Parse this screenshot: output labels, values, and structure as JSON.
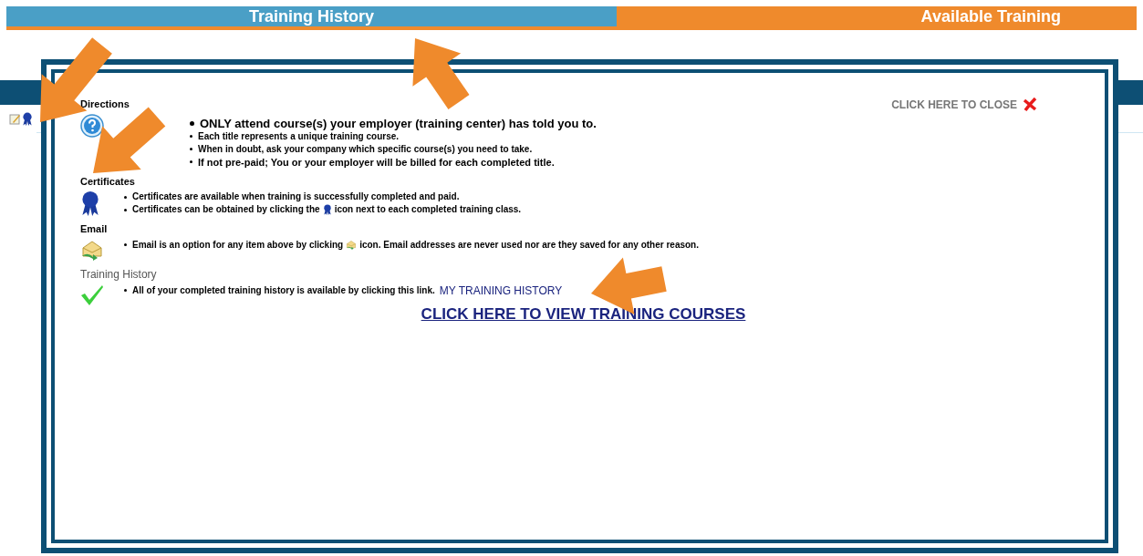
{
  "tabs": [
    {
      "label": "Training History",
      "color": "#4a9fc6"
    },
    {
      "label": "Available Training",
      "color": "#ef8a2c"
    }
  ],
  "close_link": "CLICK HERE TO CLOSE",
  "sections": [
    {
      "title": "Directions",
      "kind": "help",
      "bullets": [
        {
          "text": "ONLY attend course(s) your employer (training center) has told you to."
        },
        {
          "text": "Each title represents a unique training course."
        },
        {
          "text": "When in doubt, ask your company which specific course(s) you need to take."
        },
        {
          "text": "If not pre-paid; You or your employer will be billed for each completed title."
        }
      ]
    },
    {
      "title": "Certificates",
      "kind": "ribbon",
      "bullets": [
        {
          "text": "Certificates are available when training is successfully completed and paid."
        },
        {
          "text": "Certificates can be obtained by clicking the",
          "after": "icon next to each completed training class."
        }
      ]
    },
    {
      "title": "Email",
      "kind": "email",
      "bullets": [
        {
          "text": "Email is an option for any item above by clicking",
          "after": "icon. Email addresses are never used nor are they saved for any other reason."
        }
      ]
    },
    {
      "title": "Training History",
      "kind": "check",
      "bullets": [
        {
          "text": "All of your completed training history is available by clicking this link.",
          "link": "MY TRAINING HISTORY"
        }
      ]
    }
  ],
  "courses_link": "CLICK HERE TO VIEW TRAINING COURSES"
}
